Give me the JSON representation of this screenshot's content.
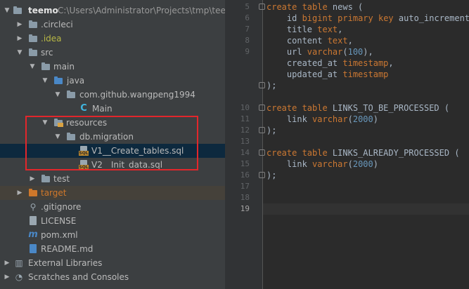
{
  "project_tree": {
    "root_name": "teemo",
    "root_path": "C:\\Users\\Administrator\\Projects\\tmp\\teemo",
    "items": [
      {
        "label": ".circleci"
      },
      {
        "label": ".idea"
      },
      {
        "label": "src"
      },
      {
        "label": "main"
      },
      {
        "label": "java"
      },
      {
        "label": "com.github.wangpeng1994"
      },
      {
        "label": "Main"
      },
      {
        "label": "resources"
      },
      {
        "label": "db.migration"
      },
      {
        "label": "V1__Create_tables.sql"
      },
      {
        "label": "V2__Init_data.sql"
      },
      {
        "label": "test"
      },
      {
        "label": "target"
      },
      {
        "label": ".gitignore"
      },
      {
        "label": "LICENSE"
      },
      {
        "label": "pom.xml"
      },
      {
        "label": "README.md"
      },
      {
        "label": "External Libraries"
      },
      {
        "label": "Scratches and Consoles"
      }
    ]
  },
  "editor": {
    "line_numbers": [
      "5",
      "6",
      "7",
      "8",
      "9",
      "10",
      "11",
      "12",
      "13",
      "14",
      "15",
      "16",
      "17",
      "18",
      "19"
    ],
    "current_line": "19",
    "code": {
      "l1": {
        "k1": "create table ",
        "t1": "news",
        "p1": " ("
      },
      "l2": {
        "a": "    id ",
        "b": "bigint",
        "c": " ",
        "d": "primary key",
        "e": " ",
        "f": "auto_increment",
        "g": ","
      },
      "l3": {
        "a": "    title ",
        "b": "text",
        "c": ","
      },
      "l4": {
        "a": "    content ",
        "b": "text",
        "c": ","
      },
      "l5": {
        "a": "    url ",
        "b": "varchar",
        "c": "(",
        "d": "100",
        "e": "),"
      },
      "l6": {
        "a": "    created_at ",
        "b": "timestamp",
        "c": ","
      },
      "l7": {
        "a": "    updated_at ",
        "b": "timestamp"
      },
      "l8": {
        "a": ");"
      },
      "l10": {
        "k1": "create table ",
        "t1": "LINKS_TO_BE_PROCESSED",
        "p1": " ("
      },
      "l11": {
        "a": "    link ",
        "b": "varchar",
        "c": "(",
        "d": "2000",
        "e": ")"
      },
      "l12": {
        "a": ");"
      },
      "l14": {
        "k1": "create table ",
        "t1": "LINKS_ALREADY_PROCESSED",
        "p1": " ("
      },
      "l15": {
        "a": "    link ",
        "b": "varchar",
        "c": "(",
        "d": "2000",
        "e": ")"
      },
      "l16": {
        "a": ");"
      }
    }
  },
  "colors": {
    "panel_bg": "#3c3f41",
    "editor_bg": "#2b2b2b",
    "keyword": "#cc7832",
    "number": "#6897bb",
    "highlight_box": "#e2262b",
    "selection": "#0d293e"
  }
}
